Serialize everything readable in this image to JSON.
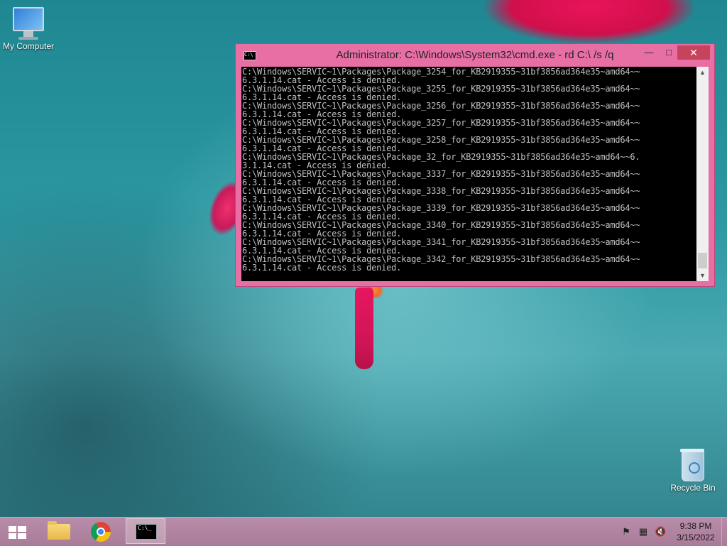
{
  "desktop": {
    "icons": [
      {
        "label": "My Computer",
        "icon": "monitor-icon"
      },
      {
        "label": "Recycle Bin",
        "icon": "recycle-bin-icon"
      }
    ]
  },
  "cmd_window": {
    "title": "Administrator: C:\\Windows\\System32\\cmd.exe - rd  C:\\ /s /q",
    "icon_text": "C:\\",
    "controls": {
      "minimize": "—",
      "maximize": "□",
      "close": "✕"
    },
    "console_lines": [
      "C:\\Windows\\SERVIC~1\\Packages\\Package_3254_for_KB2919355~31bf3856ad364e35~amd64~~",
      "6.3.1.14.cat - Access is denied.",
      "C:\\Windows\\SERVIC~1\\Packages\\Package_3255_for_KB2919355~31bf3856ad364e35~amd64~~",
      "6.3.1.14.cat - Access is denied.",
      "C:\\Windows\\SERVIC~1\\Packages\\Package_3256_for_KB2919355~31bf3856ad364e35~amd64~~",
      "6.3.1.14.cat - Access is denied.",
      "C:\\Windows\\SERVIC~1\\Packages\\Package_3257_for_KB2919355~31bf3856ad364e35~amd64~~",
      "6.3.1.14.cat - Access is denied.",
      "C:\\Windows\\SERVIC~1\\Packages\\Package_3258_for_KB2919355~31bf3856ad364e35~amd64~~",
      "6.3.1.14.cat - Access is denied.",
      "C:\\Windows\\SERVIC~1\\Packages\\Package_32_for_KB2919355~31bf3856ad364e35~amd64~~6.",
      "3.1.14.cat - Access is denied.",
      "C:\\Windows\\SERVIC~1\\Packages\\Package_3337_for_KB2919355~31bf3856ad364e35~amd64~~",
      "6.3.1.14.cat - Access is denied.",
      "C:\\Windows\\SERVIC~1\\Packages\\Package_3338_for_KB2919355~31bf3856ad364e35~amd64~~",
      "6.3.1.14.cat - Access is denied.",
      "C:\\Windows\\SERVIC~1\\Packages\\Package_3339_for_KB2919355~31bf3856ad364e35~amd64~~",
      "6.3.1.14.cat - Access is denied.",
      "C:\\Windows\\SERVIC~1\\Packages\\Package_3340_for_KB2919355~31bf3856ad364e35~amd64~~",
      "6.3.1.14.cat - Access is denied.",
      "C:\\Windows\\SERVIC~1\\Packages\\Package_3341_for_KB2919355~31bf3856ad364e35~amd64~~",
      "6.3.1.14.cat - Access is denied.",
      "C:\\Windows\\SERVIC~1\\Packages\\Package_3342_for_KB2919355~31bf3856ad364e35~amd64~~",
      "6.3.1.14.cat - Access is denied."
    ],
    "colors": {
      "frame": "#e76fa3",
      "console_bg": "#000000",
      "console_fg": "#c0c0c0",
      "close_button": "#c7435b"
    }
  },
  "taskbar": {
    "cmd_icon_text": "C:\\_",
    "items": [
      {
        "name": "file-explorer",
        "icon": "folder-icon"
      },
      {
        "name": "chrome",
        "icon": "chrome-icon"
      },
      {
        "name": "command-prompt",
        "icon": "cmd-icon",
        "active": true
      }
    ],
    "tray": {
      "icons": [
        "action-center-flag-icon",
        "network-icon",
        "volume-muted-icon"
      ],
      "time": "9:38 PM",
      "date": "3/15/2022"
    },
    "colors": {
      "taskbar": "#b88da9"
    }
  }
}
